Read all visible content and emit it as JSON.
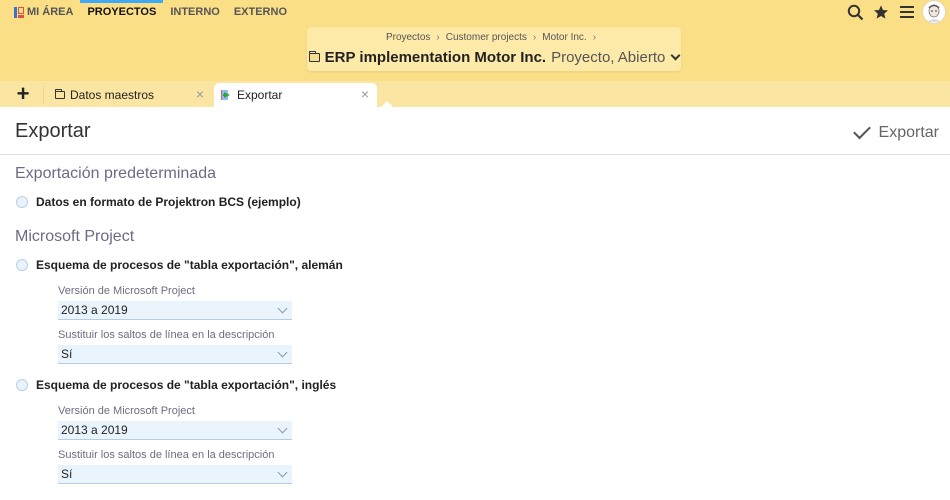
{
  "nav": {
    "items": [
      {
        "label": "MI ÁREA",
        "active": false
      },
      {
        "label": "PROYECTOS",
        "active": true
      },
      {
        "label": "INTERNO",
        "active": false
      },
      {
        "label": "EXTERNO",
        "active": false
      }
    ],
    "accent": "#3fa9f5"
  },
  "header_icons": [
    "search-icon",
    "star-icon",
    "menu-icon",
    "avatar"
  ],
  "breadcrumb": {
    "items": [
      "Proyectos",
      "Customer projects",
      "Motor Inc."
    ],
    "separator": "›",
    "title": "ERP implementation Motor Inc.",
    "subtitle": "Proyecto, Abierto"
  },
  "tabs": {
    "add_label": "+",
    "items": [
      {
        "label": "Datos maestros",
        "icon": "folder-icon",
        "active": false
      },
      {
        "label": "Exportar",
        "icon": "export-icon",
        "active": true
      }
    ],
    "close_glyph": "×"
  },
  "page": {
    "title": "Exportar",
    "action_label": "Exportar"
  },
  "sections": [
    {
      "title": "Exportación predeterminada",
      "options": [
        {
          "label": "Datos en formato de Projektron BCS (ejemplo)"
        }
      ]
    },
    {
      "title": "Microsoft Project",
      "options": [
        {
          "label": "Esquema de procesos de \"tabla exportación\", alemán",
          "fields": [
            {
              "label": "Versión de Microsoft Project",
              "value": "2013 a 2019"
            },
            {
              "label": "Sustituir los saltos de línea en la descripción",
              "value": "Sí"
            }
          ]
        },
        {
          "label": "Esquema de procesos de \"tabla exportación\", inglés",
          "fields": [
            {
              "label": "Versión de Microsoft Project",
              "value": "2013 a 2019"
            },
            {
              "label": "Sustituir los saltos de línea en la descripción",
              "value": "Sí"
            }
          ]
        }
      ]
    }
  ]
}
